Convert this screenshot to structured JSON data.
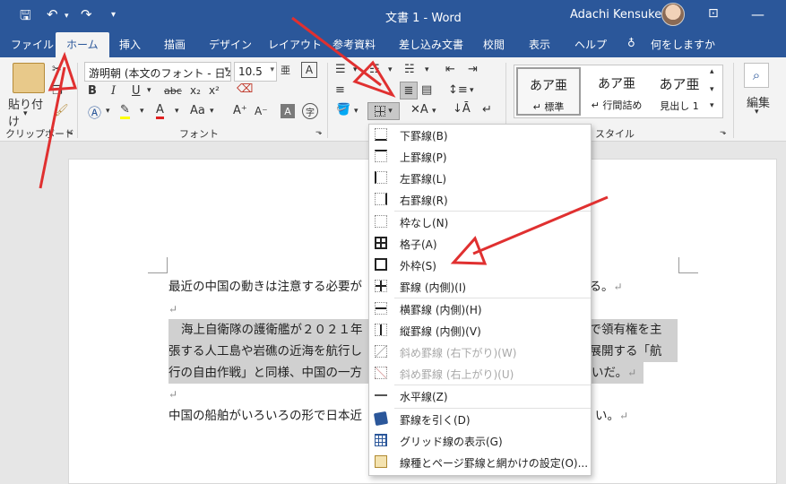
{
  "titlebar": {
    "doc_title": "文書 1  -  Word",
    "user_name": "Adachi Kensuke"
  },
  "tabs": [
    "ファイル",
    "ホーム",
    "挿入",
    "描画",
    "デザイン",
    "レイアウト",
    "参考資料",
    "差し込み文書",
    "校閲",
    "表示",
    "ヘルプ"
  ],
  "tell_me": "何をしますか",
  "ribbon": {
    "paste_label": "貼り付け",
    "clipboard_label": "クリップボード",
    "font_label": "フォント",
    "style_label": "スタイル",
    "edit_label": "編集",
    "font_name": "游明朝 (本文のフォント - 日本",
    "font_size": "10.5",
    "styles": [
      {
        "preview": "あア亜",
        "name": "↵ 標準"
      },
      {
        "preview": "あア亜",
        "name": "↵ 行間詰め"
      },
      {
        "preview": "あア亜",
        "name": "見出し 1"
      }
    ]
  },
  "document": {
    "line1": "最近の中国の動きは注意する必要が",
    "line1_end": "いる。",
    "line3a": "海上自衛隊の護衛艦が２０２１年",
    "line3a_end": "海で領有権を主",
    "line3b": "張する人工島や岩礁の近海を航行し",
    "line3b_end": "で展開する「航",
    "line3c": "行の自由作戦」と同様、中国の一方",
    "line3c_end": "いだ。",
    "line5": "中国の船舶がいろいろの形で日本近",
    "line5_end": "い。",
    "para_mark": "↵"
  },
  "border_menu": {
    "items": [
      {
        "label": "下罫線(B)",
        "icon": "bottom-border-icon",
        "disabled": false
      },
      {
        "label": "上罫線(P)",
        "icon": "top-border-icon",
        "disabled": false
      },
      {
        "label": "左罫線(L)",
        "icon": "left-border-icon",
        "disabled": false
      },
      {
        "label": "右罫線(R)",
        "icon": "right-border-icon",
        "disabled": false
      },
      {
        "label": "枠なし(N)",
        "icon": "no-border-icon",
        "disabled": false
      },
      {
        "label": "格子(A)",
        "icon": "all-borders-icon",
        "disabled": false
      },
      {
        "label": "外枠(S)",
        "icon": "outside-borders-icon",
        "disabled": false
      },
      {
        "label": "罫線 (内側)(I)",
        "icon": "inside-borders-icon",
        "disabled": false
      },
      {
        "label": "横罫線 (内側)(H)",
        "icon": "inside-horizontal-border-icon",
        "disabled": false
      },
      {
        "label": "縦罫線 (内側)(V)",
        "icon": "inside-vertical-border-icon",
        "disabled": false
      },
      {
        "label": "斜め罫線 (右下がり)(W)",
        "icon": "diagonal-down-border-icon",
        "disabled": true
      },
      {
        "label": "斜め罫線 (右上がり)(U)",
        "icon": "diagonal-up-border-icon",
        "disabled": true
      },
      {
        "label": "水平線(Z)",
        "icon": "horizontal-line-icon",
        "disabled": false
      },
      {
        "label": "罫線を引く(D)",
        "icon": "draw-table-icon",
        "disabled": false
      },
      {
        "label": "グリッド線の表示(G)",
        "icon": "view-gridlines-icon",
        "disabled": false
      },
      {
        "label": "線種とページ罫線と網かけの設定(O)...",
        "icon": "borders-and-shading-icon",
        "disabled": false
      }
    ]
  },
  "colors": {
    "title_bar": "#2b579a",
    "ribbon_bg": "#f3f3f3",
    "annotation_arrow": "#e03030",
    "selection": "#d0d0d0"
  }
}
